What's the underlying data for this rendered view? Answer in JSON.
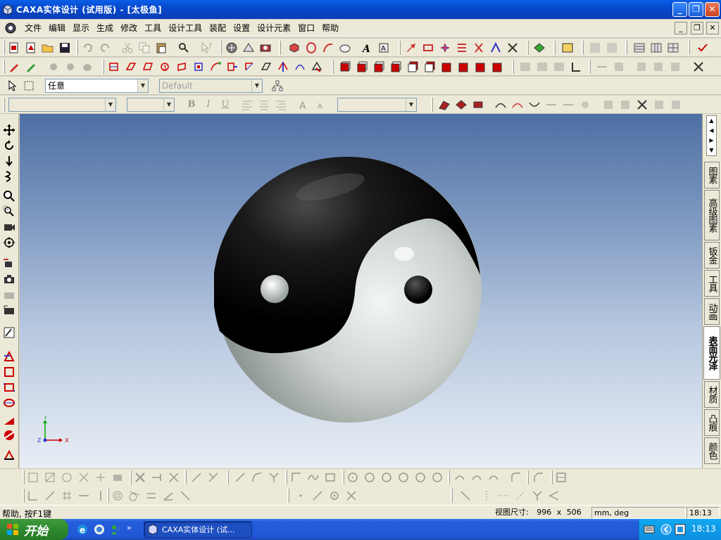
{
  "window": {
    "title": "CAXA实体设计 (试用版) - [太极鱼]",
    "minimize": "_",
    "maximize": "❐",
    "close": "✕"
  },
  "menu": {
    "items": [
      "文件",
      "编辑",
      "显示",
      "生成",
      "修改",
      "工具",
      "设计工具",
      "装配",
      "设置",
      "设计元素",
      "窗口",
      "帮助"
    ]
  },
  "selection": {
    "filter_value": "任意",
    "config_value": "Default"
  },
  "format": {
    "bold": "B",
    "italic": "I",
    "underline": "U"
  },
  "design_tabs": [
    "图素",
    "高级图素",
    "钣金",
    "工具",
    "动画",
    "表面光泽",
    "材质",
    "凸痕",
    "颜色"
  ],
  "active_tab": "表面光泽",
  "axis": {
    "x": "X",
    "y": "Y",
    "z": "Z"
  },
  "status": {
    "help": "帮助, 按F1键",
    "view_size_label": "视图尺寸:",
    "view_width": "996",
    "view_x": "x",
    "view_height": "506",
    "units": "mm, deg",
    "time": "18:13"
  },
  "taskbar": {
    "start_label": "开始",
    "app_label": "CAXA实体设计 (试...",
    "clock": "18:13",
    "chevron": "»"
  },
  "colors": {
    "title_bar": "#0a5fe8",
    "viewport_top": "#4d6fa3",
    "viewport_bottom": "#e9eef6",
    "taskbar": "#245edb"
  }
}
